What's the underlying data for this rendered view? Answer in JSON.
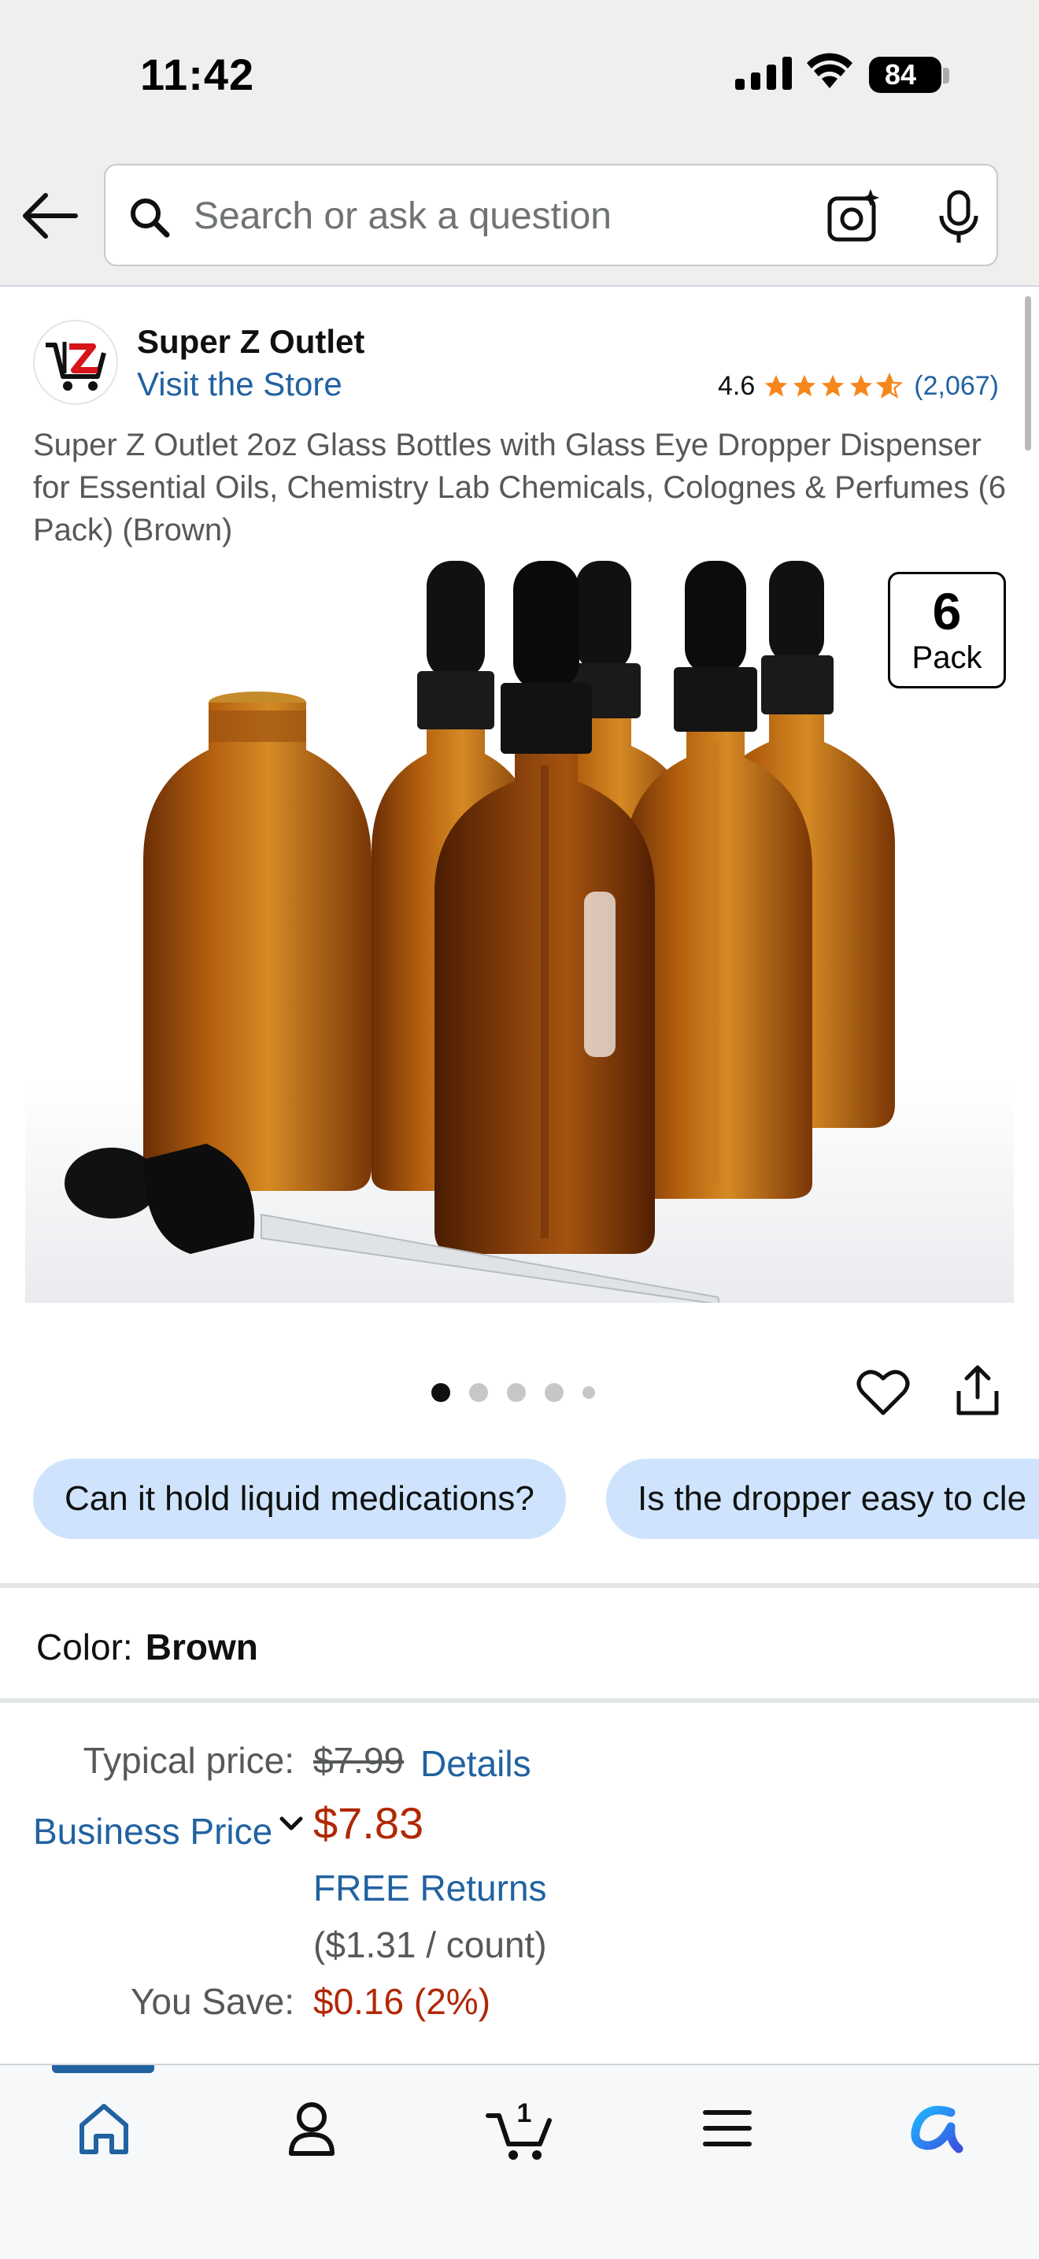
{
  "status_bar": {
    "time": "11:42",
    "battery": "84"
  },
  "search": {
    "placeholder": "Search or ask a question",
    "value": ""
  },
  "store": {
    "name": "Super Z Outlet",
    "visit_label": "Visit the Store",
    "rating": "4.6",
    "rating_count": "(2,067)",
    "stars_filled": 4.6
  },
  "product": {
    "title": "Super Z Outlet 2oz Glass Bottles with Glass Eye Dropper Dispenser for Essential Oils, Chemistry Lab Chemicals, Colognes & Perfumes (6 Pack) (Brown)",
    "badge_number": "6",
    "badge_word": "Pack",
    "image_count": 5,
    "image_index": 1
  },
  "chips": [
    "Can it hold liquid medications?",
    "Is the dropper easy to cle"
  ],
  "color": {
    "label": "Color:",
    "value": "Brown"
  },
  "pricing": {
    "typical_label": "Typical price:",
    "typical_value": "$7.99",
    "details_label": "Details",
    "business_label": "Business Price",
    "price": "$7.83",
    "free_returns": "FREE Returns",
    "per_count": "($1.31 / count)",
    "you_save_label": "You Save:",
    "you_save_value": "$0.16 (2%)"
  },
  "bottom_nav": {
    "items": [
      "home-icon",
      "account-icon",
      "cart-icon",
      "menu-icon",
      "rufus-icon"
    ],
    "cart_count": "1",
    "active": "home"
  },
  "colors": {
    "link": "#2162a1",
    "price_red": "#b12704",
    "star_orange": "#f7861c",
    "chip_bg": "#cfe4fc"
  }
}
